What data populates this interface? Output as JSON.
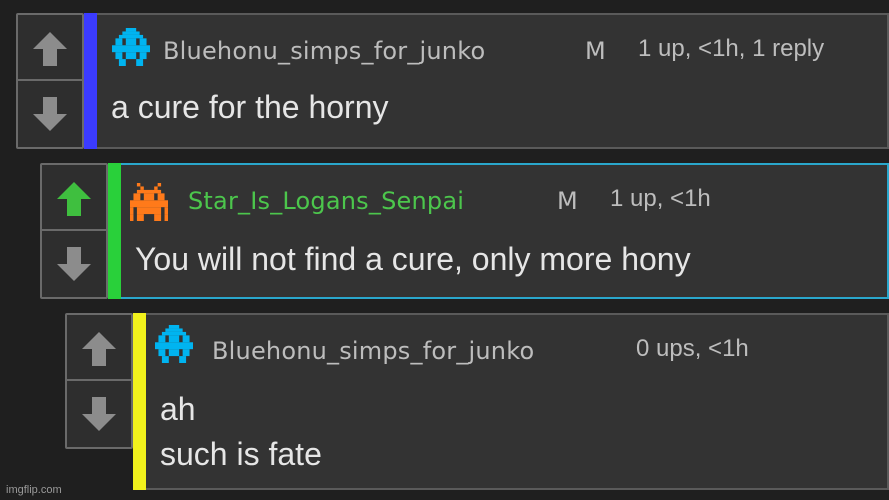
{
  "comments": [
    {
      "username": "Bluehonu_simps_for_junko",
      "mod_badge": "M",
      "meta": "1 up, <1h, 1 reply",
      "text_lines": [
        "a cure for the horny"
      ],
      "level_color": "#3b3bff",
      "username_color": "#bdbdbd",
      "avatar_color": "#00b4f0",
      "upvoted": false
    },
    {
      "username": "Star_Is_Logans_Senpai",
      "mod_badge": "M",
      "meta": "1 up, <1h",
      "text_lines": [
        "You will not find a cure, only more hony"
      ],
      "level_color": "#29d03a",
      "username_color": "#4cc64c",
      "avatar_color": "#ff7a1a",
      "upvoted": true
    },
    {
      "username": "Bluehonu_simps_for_junko",
      "mod_badge": "",
      "meta": "0 ups, <1h",
      "text_lines": [
        "ah",
        "such is fate"
      ],
      "level_color": "#f2f21c",
      "username_color": "#bdbdbd",
      "avatar_color": "#00b4f0",
      "upvoted": false
    }
  ],
  "icons": {
    "upvote": "up-arrow-icon",
    "downvote": "down-arrow-icon",
    "avatar": "space-invader-icon"
  },
  "colors": {
    "arrow_default": "#8c8c8c",
    "arrow_upvoted": "#3fbf3f",
    "highlight_border": "#2aa7cc"
  },
  "watermark": "imgflip.com"
}
